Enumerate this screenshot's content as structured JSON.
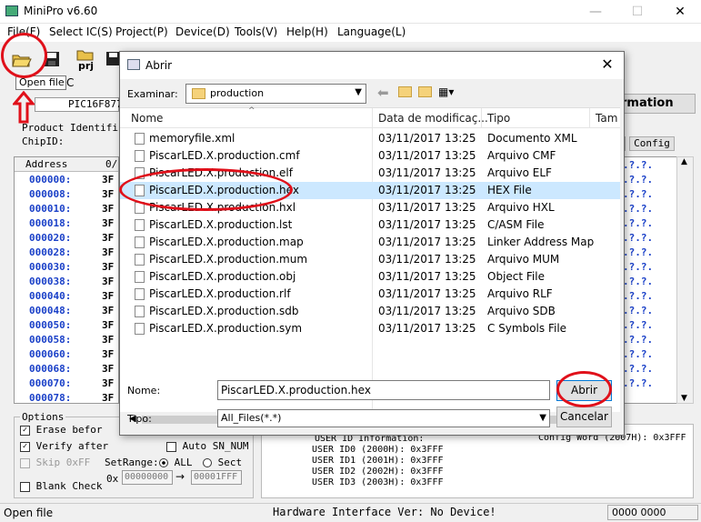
{
  "window": {
    "title": "MiniPro v6.60",
    "min": "—",
    "max": "☐",
    "close": "✕"
  },
  "menu": [
    "File(F)",
    "Select IC(S)",
    "Project(P)",
    "Device(D)",
    "Tools(V)",
    "Help(H)",
    "Language(L)"
  ],
  "toolbar": {
    "prj_label": "prj",
    "tooltip": "Open file"
  },
  "chip": {
    "name": "PIC16F877",
    "c_fragment": "C",
    "product_label": "Product Identifica",
    "chipid_label": "ChipID:",
    "info_button": "rmation",
    "config_button": "Config",
    "cfg_prefix": "p"
  },
  "grid": {
    "headers": [
      "Address",
      "0/"
    ],
    "rows": [
      {
        "addr": "000000:",
        "val": "3F"
      },
      {
        "addr": "000008:",
        "val": "3F"
      },
      {
        "addr": "000010:",
        "val": "3F"
      },
      {
        "addr": "000018:",
        "val": "3F"
      },
      {
        "addr": "000020:",
        "val": "3F"
      },
      {
        "addr": "000028:",
        "val": "3F"
      },
      {
        "addr": "000030:",
        "val": "3F"
      },
      {
        "addr": "000038:",
        "val": "3F"
      },
      {
        "addr": "000040:",
        "val": "3F"
      },
      {
        "addr": "000048:",
        "val": "3F"
      },
      {
        "addr": "000050:",
        "val": "3F"
      },
      {
        "addr": "000058:",
        "val": "3F"
      },
      {
        "addr": "000060:",
        "val": "3F"
      },
      {
        "addr": "000068:",
        "val": "3F"
      },
      {
        "addr": "000070:",
        "val": "3F"
      },
      {
        "addr": "000078:",
        "val": "3F"
      }
    ],
    "right_cell": ".?.?."
  },
  "options": {
    "title": "Options",
    "erase": "Erase befor",
    "verify": "Verify after",
    "skip": "Skip 0xFF",
    "blank": "Blank Check",
    "auto_sn": "Auto SN_NUM",
    "setrange": "SetRange:",
    "all": "ALL",
    "sect": "Sect",
    "ox": "0x",
    "from": "00000000",
    "to": "00001FFF"
  },
  "info": {
    "config_word": "Config Word (2007H): 0x3FFF",
    "uid_title": "USER ID Information:",
    "uids": [
      "USER ID0 (2000H): 0x3FFF",
      "USER ID1 (2001H): 0x3FFF",
      "USER ID2 (2002H): 0x3FFF",
      "USER ID3 (2003H): 0x3FFF"
    ]
  },
  "status": {
    "left": "Open file",
    "hw": "Hardware Interface Ver: No Device!",
    "right": "0000 0000"
  },
  "dialog": {
    "title": "Abrir",
    "lookin_label": "Examinar:",
    "lookin_value": "production",
    "columns": [
      "Nome",
      "Data de modificaç...",
      "Tipo",
      "Tam"
    ],
    "files": [
      {
        "name": "memoryfile.xml",
        "date": "03/11/2017 13:25",
        "type": "Documento XML"
      },
      {
        "name": "PiscarLED.X.production.cmf",
        "date": "03/11/2017 13:25",
        "type": "Arquivo CMF"
      },
      {
        "name": "PiscarLED.X.production.elf",
        "date": "03/11/2017 13:25",
        "type": "Arquivo ELF"
      },
      {
        "name": "PiscarLED.X.production.hex",
        "date": "03/11/2017 13:25",
        "type": "HEX File"
      },
      {
        "name": "PiscarLED.X.production.hxl",
        "date": "03/11/2017 13:25",
        "type": "Arquivo HXL"
      },
      {
        "name": "PiscarLED.X.production.lst",
        "date": "03/11/2017 13:25",
        "type": "C/ASM File"
      },
      {
        "name": "PiscarLED.X.production.map",
        "date": "03/11/2017 13:25",
        "type": "Linker Address Map"
      },
      {
        "name": "PiscarLED.X.production.mum",
        "date": "03/11/2017 13:25",
        "type": "Arquivo MUM"
      },
      {
        "name": "PiscarLED.X.production.obj",
        "date": "03/11/2017 13:25",
        "type": "Object File"
      },
      {
        "name": "PiscarLED.X.production.rlf",
        "date": "03/11/2017 13:25",
        "type": "Arquivo RLF"
      },
      {
        "name": "PiscarLED.X.production.sdb",
        "date": "03/11/2017 13:25",
        "type": "Arquivo SDB"
      },
      {
        "name": "PiscarLED.X.production.sym",
        "date": "03/11/2017 13:25",
        "type": "C Symbols File"
      }
    ],
    "selected_index": 3,
    "name_label": "Nome:",
    "name_value": "PiscarLED.X.production.hex",
    "type_label": "Tipo:",
    "type_value": "All_Files(*.*)",
    "open_button": "Abrir",
    "cancel_button": "Cancelar"
  },
  "colors": {
    "highlight": "#e0101a",
    "selection": "#cce8ff",
    "address_blue": "#1a40c8"
  }
}
